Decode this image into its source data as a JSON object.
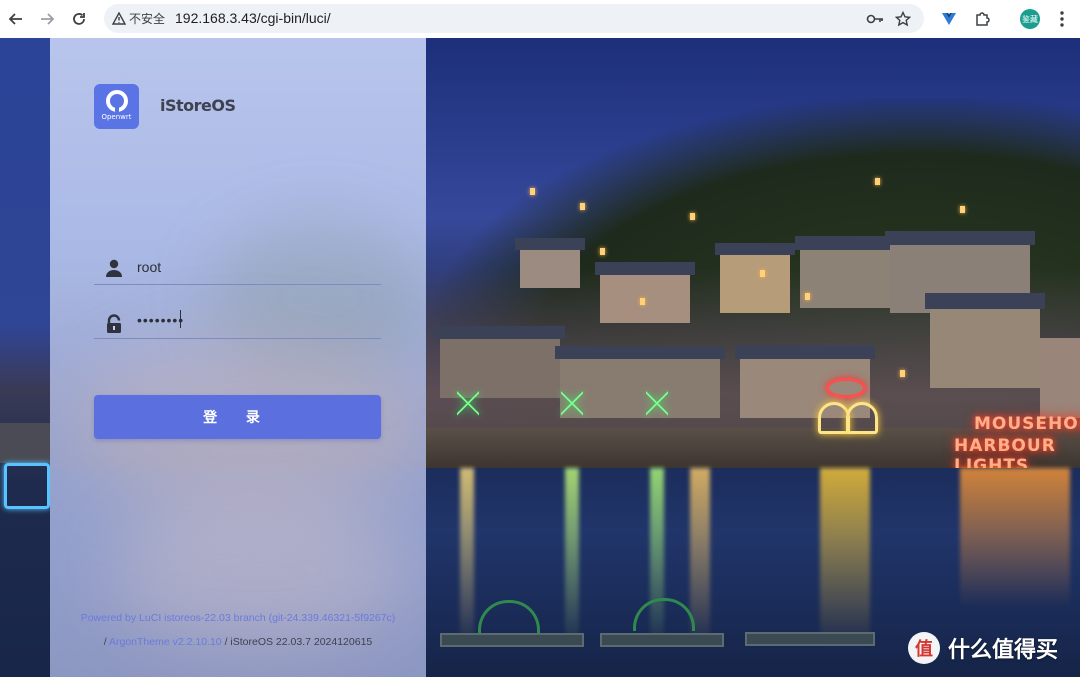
{
  "browser": {
    "security_label": "不安全",
    "url": "192.168.3.43/cgi-bin/luci/",
    "profile_initial": "鉴藏"
  },
  "icons": {
    "back": "arrow-left-icon",
    "forward": "arrow-right-icon",
    "reload": "reload-icon",
    "warning": "warning-triangle-icon",
    "password_manager": "key-icon",
    "bookmark": "star-icon",
    "extension_v": "vue-extension-icon",
    "extensions": "puzzle-icon",
    "menu": "more-vert-icon",
    "user": "user-icon",
    "lock": "lock-icon"
  },
  "login": {
    "logo_text": "Openwrt",
    "brand": "iStoreOS",
    "username": "root",
    "password_mask": "••••••••",
    "submit_label": "登 录"
  },
  "footer": {
    "line1": "Powered by LuCI istoreos-22.03 branch (git-24.339.46321-5f9267c)",
    "line2_prefix": "/",
    "theme_link": "ArgonTheme v2.2.10.10",
    "line2_suffix": "/ iStoreOS 22.03.7 2024120615"
  },
  "scene": {
    "sign_line1": "MOUSEHOLE",
    "sign_line2": "HARBOUR LIGHTS"
  },
  "watermark": {
    "badge": "值",
    "text": "什么值得买"
  },
  "colors": {
    "accent": "#5c6fdf",
    "link": "#6a7bdc"
  }
}
